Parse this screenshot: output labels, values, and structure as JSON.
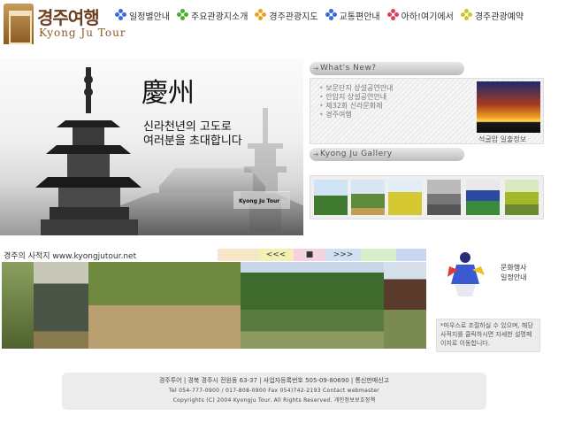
{
  "logo": {
    "korean": "경주여행",
    "english": "Kyong Ju Tour"
  },
  "nav": {
    "items": [
      {
        "label": "일정별안내",
        "dots": [
          "#3a6bd8",
          "#3a6bd8",
          "#3a6bd8",
          "#3a6bd8"
        ]
      },
      {
        "label": "주요관광지소개",
        "dots": [
          "#4caf32",
          "#4caf32",
          "#4caf32",
          "#4caf32"
        ]
      },
      {
        "label": "경주관광지도",
        "dots": [
          "#f0a020",
          "#f0a020",
          "#f0a020",
          "#f0a020"
        ]
      },
      {
        "label": "교통편안내",
        "dots": [
          "#3a6bd8",
          "#3a6bd8",
          "#3a6bd8",
          "#3a6bd8"
        ]
      },
      {
        "label": "아하!여기에서",
        "dots": [
          "#e04060",
          "#e04060",
          "#e04060",
          "#e04060"
        ]
      },
      {
        "label": "경주관광예약",
        "dots": [
          "#c8c820",
          "#c8c820",
          "#c8c820",
          "#c8c820"
        ]
      }
    ]
  },
  "hero": {
    "title": "慶州",
    "subtitle_line1": "신라천년의 고도로",
    "subtitle_line2": "여러분을 초대합니다",
    "tag": "Kyong Ju Tour"
  },
  "whats_new": {
    "heading": "What's New?",
    "items": [
      "보문단지 상설공연안내",
      "안압지 상설공연안내",
      "제32회 신라문화제",
      "경주여행"
    ],
    "image_caption": "석굴암 일출정보"
  },
  "gallery": {
    "heading": "Kyong Ju Gallery"
  },
  "strip": {
    "title": "경주의 사적지 www.kyongjutour.net",
    "prev": "<<<",
    "stop": "■",
    "next": ">>>"
  },
  "event": {
    "label_line1": "문화행사",
    "label_line2": "일정안내",
    "note": "*마우스로 조절하실 수 있으며, 해당 사적지를 클릭하시면 자세한 설명페이지로 이동합니다."
  },
  "footer": {
    "line1": "경주투어 | 경북 경주시 전원동 63-37 | 사업자등록번호 505-09-80690 | 통신판매신고",
    "line2_prefix": "Tel 054-777-0900 / 017-808-0900 Fax 054)742-2193",
    "contact_label": "Contact webmaster",
    "line3_prefix": "Copyrights (C) 2004 Kyongju Tour. All Rights Reserved.",
    "privacy_label": "개인정보보호정책"
  },
  "colors": {
    "accent": "#8a5a22",
    "header_bar": "#bdbdbd"
  }
}
